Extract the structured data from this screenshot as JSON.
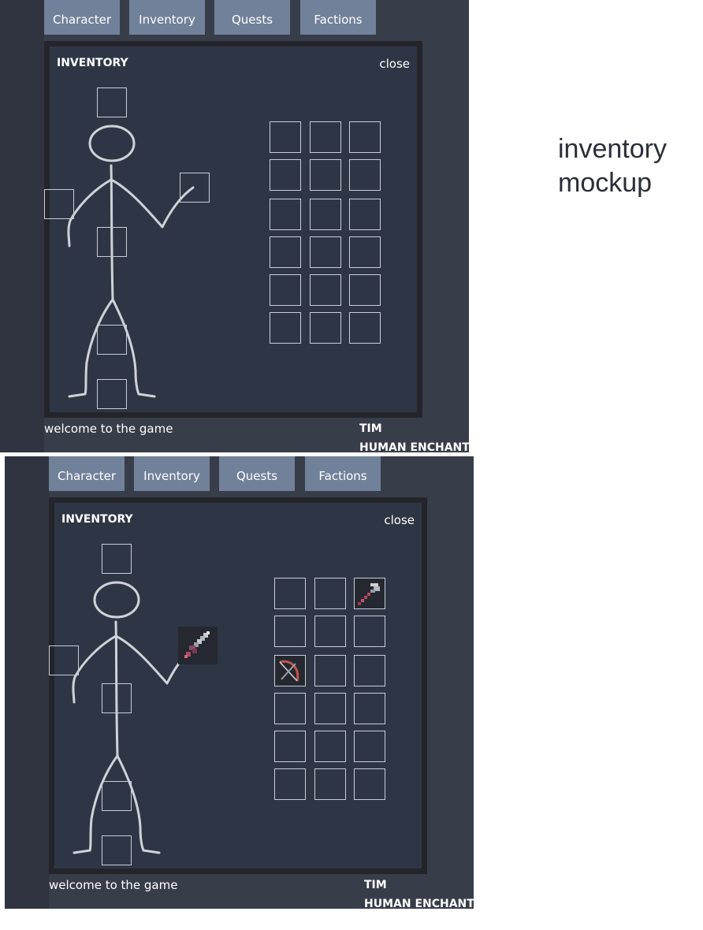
{
  "tabs": [
    "Character",
    "Inventory",
    "Quests",
    "Factions"
  ],
  "panel": {
    "title": "INVENTORY",
    "close_label": "close"
  },
  "status_message": "welcome to the game",
  "player": {
    "name": "TIM",
    "race_class": "HUMAN ENCHANT"
  },
  "caption": {
    "line1": "inventory",
    "line2": "mockup"
  },
  "mockup_after": {
    "equipped_weapon_icon": "sword-icon",
    "bag_items": [
      {
        "slot": "row1-col3",
        "icon": "axe-icon"
      },
      {
        "slot": "row3-col1",
        "icon": "bow-icon"
      }
    ]
  },
  "colors": {
    "background": "#383d4a",
    "panel": "#2e3646",
    "panel_border": "#23252b",
    "tab": "#72819a",
    "green_bar": "#3fd06d",
    "red_bar": "#c94b44"
  }
}
